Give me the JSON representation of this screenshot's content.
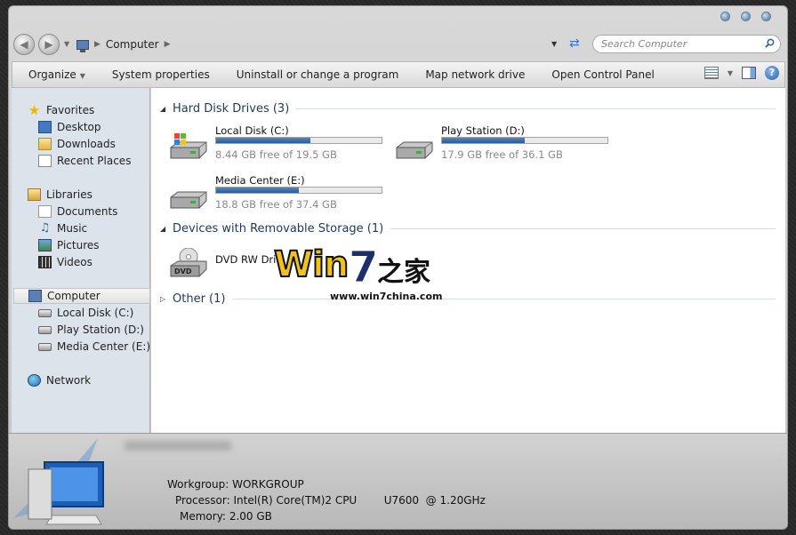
{
  "address": {
    "breadcrumb": "Computer",
    "search_placeholder": "Search Computer"
  },
  "toolbar": {
    "organize": "Organize",
    "system_properties": "System properties",
    "uninstall": "Uninstall or change a program",
    "map_drive": "Map network drive",
    "control_panel": "Open Control Panel"
  },
  "sidebar": {
    "favorites": "Favorites",
    "desktop": "Desktop",
    "downloads": "Downloads",
    "recent": "Recent Places",
    "libraries": "Libraries",
    "documents": "Documents",
    "music": "Music",
    "pictures": "Pictures",
    "videos": "Videos",
    "computer": "Computer",
    "local_disk": "Local Disk (C:)",
    "play_station": "Play Station (D:)",
    "media_center": "Media Center (E:)",
    "network": "Network"
  },
  "groups": {
    "hard_disks": "Hard Disk Drives (3)",
    "removable": "Devices with Removable Storage (1)",
    "other": "Other (1)"
  },
  "drives": [
    {
      "name": "Local Disk (C:)",
      "free": "8.44 GB free of 19.5 GB",
      "used_fraction": 0.57
    },
    {
      "name": "Play Station (D:)",
      "free": "17.9 GB free of 36.1 GB",
      "used_fraction": 0.5
    },
    {
      "name": "Media Center (E:)",
      "free": "18.8 GB free of 37.4 GB",
      "used_fraction": 0.5
    }
  ],
  "dvd": {
    "name": "DVD RW Dri",
    "label": "DVD"
  },
  "watermark": {
    "win": "Win",
    "seven": "7",
    "cn": "之家",
    "url": "www.win7china.com"
  },
  "details": {
    "workgroup_label": "Workgroup:",
    "workgroup_value": "WORKGROUP",
    "processor_label": "Processor:",
    "processor_value": "Intel(R) Core(TM)2 CPU        U7600  @ 1.20GHz",
    "memory_label": "Memory:",
    "memory_value": "2.00 GB"
  },
  "colors": {
    "bar_fill": "#2a5d99",
    "group_title": "#1e395b",
    "accent": "#3f76c4"
  }
}
